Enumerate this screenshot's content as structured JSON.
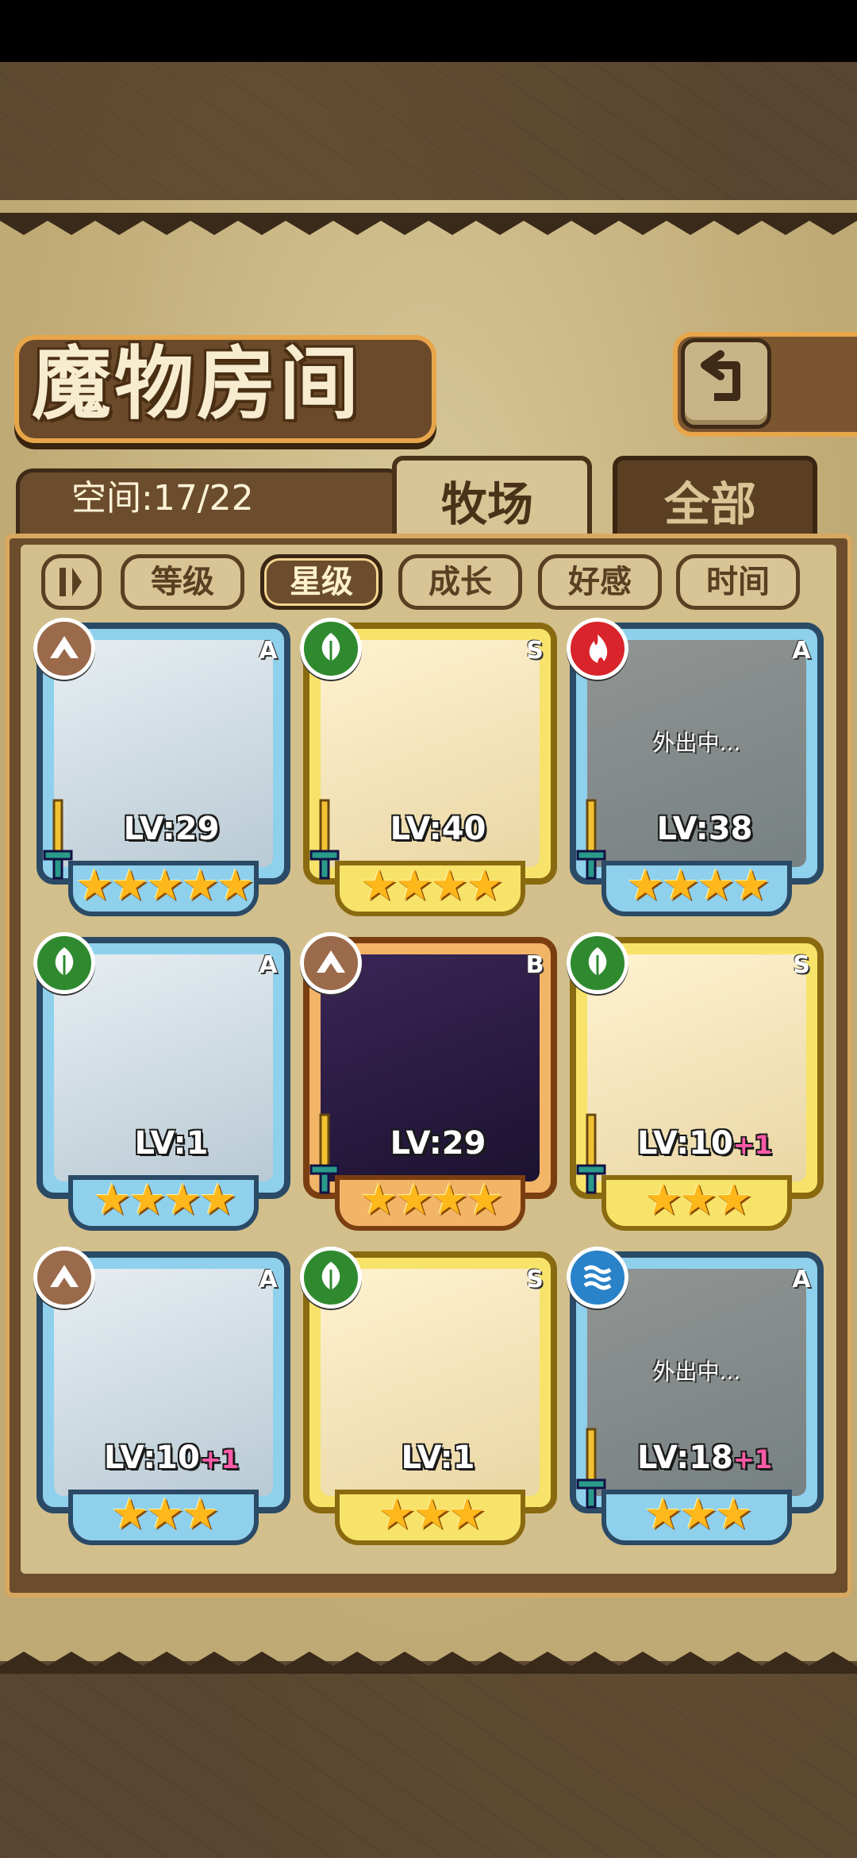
{
  "title": "魔物房间",
  "space_label": "空间:17/22",
  "tabs": [
    {
      "label": "牧场",
      "active": true
    },
    {
      "label": "全部",
      "active": false
    }
  ],
  "sort_buttons": [
    {
      "label": "等级",
      "active": false
    },
    {
      "label": "星级",
      "active": true
    },
    {
      "label": "成长",
      "active": false
    },
    {
      "label": "好感",
      "active": false
    },
    {
      "label": "时间",
      "active": false
    }
  ],
  "cards": [
    {
      "element": "earth-icon",
      "grade": "A",
      "level": "LV:29",
      "plus": "",
      "stars": "★★★★★",
      "away": "",
      "frame": "blue"
    },
    {
      "element": "leaf-icon",
      "grade": "S",
      "level": "LV:40",
      "plus": "",
      "stars": "★★★★",
      "away": "",
      "frame": "gold"
    },
    {
      "element": "fire-icon",
      "grade": "A",
      "level": "LV:38",
      "plus": "",
      "stars": "★★★★",
      "away": "外出中...",
      "frame": "blue"
    },
    {
      "element": "leaf-icon",
      "grade": "A",
      "level": "LV:1",
      "plus": "",
      "stars": "★★★★",
      "away": "",
      "frame": "blue"
    },
    {
      "element": "earth-icon",
      "grade": "B",
      "level": "LV:29",
      "plus": "",
      "stars": "★★★★",
      "away": "",
      "frame": "orange"
    },
    {
      "element": "leaf-icon",
      "grade": "S",
      "level": "LV:10",
      "plus": "+1",
      "stars": "★★★",
      "away": "",
      "frame": "gold"
    },
    {
      "element": "earth-icon",
      "grade": "A",
      "level": "LV:10",
      "plus": "+1",
      "stars": "★★★",
      "away": "",
      "frame": "blue"
    },
    {
      "element": "leaf-icon",
      "grade": "S",
      "level": "LV:1",
      "plus": "",
      "stars": "★★★",
      "away": "",
      "frame": "gold"
    },
    {
      "element": "water-icon",
      "grade": "A",
      "level": "LV:18",
      "plus": "+1",
      "stars": "★★★",
      "away": "外出中...",
      "frame": "blue"
    }
  ],
  "colors": {
    "blue_frame": "#5fb6de",
    "gold_frame": "#f2d23c",
    "orange_frame": "#e9973e",
    "earth": "#9a6a4a",
    "leaf": "#2f8a2f",
    "fire": "#d8242a",
    "water": "#2a82c8"
  }
}
